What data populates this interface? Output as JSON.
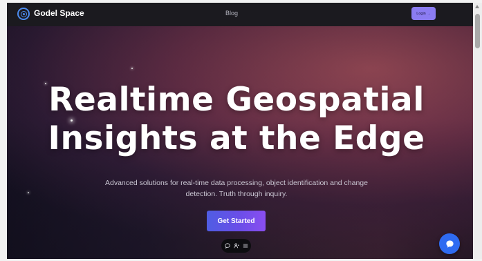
{
  "navbar": {
    "brand": "Godel Space",
    "brand_icon": "logo-icon",
    "links": [
      {
        "label": "Blog"
      }
    ],
    "login_label": "Login",
    "login_icon": "arrow-right-icon"
  },
  "hero": {
    "headline_line1": "Realtime Geospatial",
    "headline_line2": "Insights at the Edge",
    "subtitle_line1": "Advanced solutions for real-time data processing, object identification and change",
    "subtitle_line2": "detection. Truth through inquiry.",
    "cta_label": "Get Started"
  },
  "toolbar": {
    "icons": [
      "chat-bubble-icon",
      "person-icon",
      "menu-icon"
    ]
  },
  "chat_widget": {
    "icon": "chat-icon"
  },
  "colors": {
    "accent": "#8b7cf2",
    "cta_start": "#4f5de3",
    "cta_end": "#8a4ef0",
    "chat_blue": "#2f6bf1",
    "navbar_bg": "#1b1a1f"
  }
}
